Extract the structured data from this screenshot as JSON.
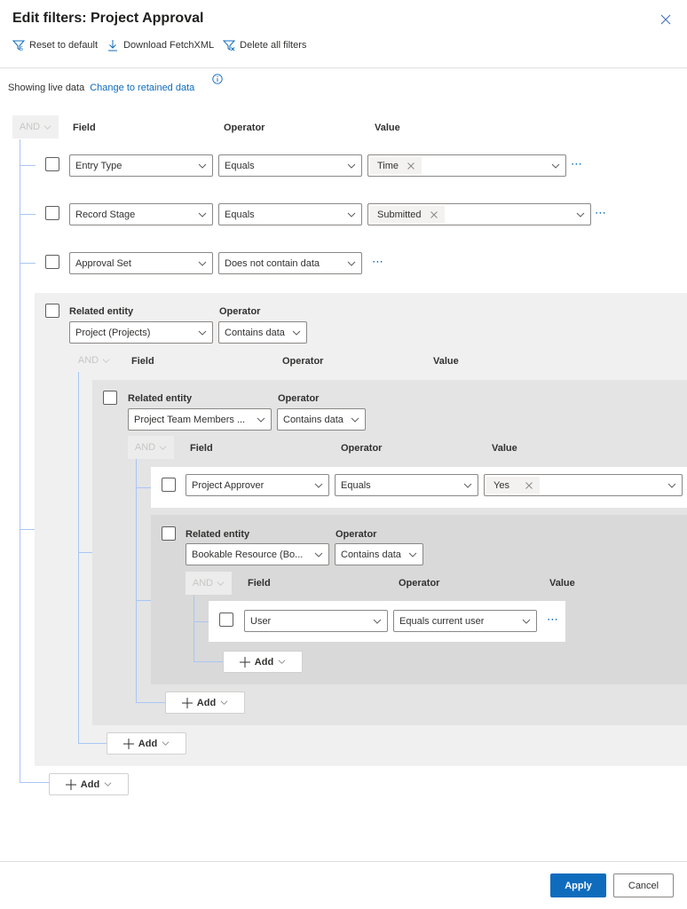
{
  "dialog": {
    "title": "Edit filters: Project Approval",
    "close_icon": "close-icon"
  },
  "toolbar": {
    "reset_label": "Reset to default",
    "download_label": "Download FetchXML",
    "delete_label": "Delete all filters"
  },
  "data_source": {
    "status_text": "Showing live data",
    "change_link": "Change to retained data"
  },
  "headers": {
    "field": "Field",
    "operator": "Operator",
    "value": "Value",
    "related_entity": "Related entity",
    "and": "AND"
  },
  "root_group": {
    "rows": [
      {
        "field": "Entry Type",
        "operator": "Equals",
        "value_tag": "Time"
      },
      {
        "field": "Record Stage",
        "operator": "Equals",
        "value_tag": "Submitted"
      },
      {
        "field": "Approval Set",
        "operator": "Does not contain data"
      }
    ],
    "related": {
      "entity": "Project (Projects)",
      "operator": "Contains data",
      "related": {
        "entity": "Project Team Members ...",
        "operator": "Contains data",
        "rows": [
          {
            "field": "Project Approver",
            "operator": "Equals",
            "value_tag": "Yes"
          }
        ],
        "related": {
          "entity": "Bookable Resource (Bo...",
          "operator": "Contains data",
          "rows": [
            {
              "field": "User",
              "operator": "Equals current user"
            }
          ]
        }
      }
    }
  },
  "add_label": "Add",
  "footer": {
    "apply_label": "Apply",
    "cancel_label": "Cancel"
  },
  "colors": {
    "accent": "#0f6cbd",
    "tree_line": "#a8c6f5"
  }
}
